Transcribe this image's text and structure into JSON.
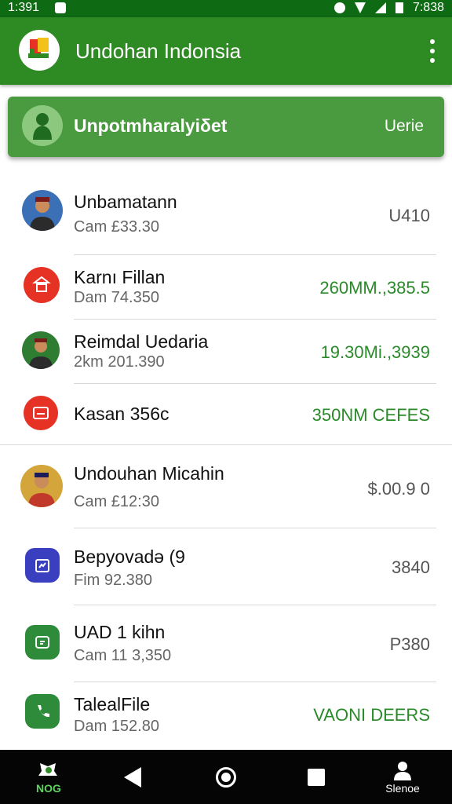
{
  "status_bar": {
    "time": "1:391",
    "right_time": "7:838"
  },
  "app_bar": {
    "title": "Undohan Indonsia"
  },
  "banner": {
    "title": "Unpotmharalyiδet",
    "action": "Uerie"
  },
  "rows": [
    {
      "name": "Unbamatann",
      "sub": "Cam £33.30",
      "value": "U410",
      "value_color": "gray",
      "avatar": "person-icon",
      "avatar_bg": "#3b6fb6"
    },
    {
      "name": "Karnı Fillan",
      "sub": "Dam 74.350",
      "value": "260MM.,385.5",
      "value_color": "green",
      "avatar": "temple-icon",
      "avatar_bg": "#e53225"
    },
    {
      "name": "Reimdal Uedaria",
      "sub": "2km 201.390",
      "value": "19.30Mi.,3939",
      "value_color": "green",
      "avatar": "person-icon",
      "avatar_bg": "#2e7d32"
    },
    {
      "name": "Kasan 356c",
      "sub": "",
      "value": "350NM CEFES",
      "value_color": "green",
      "avatar": "tv-icon",
      "avatar_bg": "#e53225"
    },
    {
      "name": "Undouhan Micahin",
      "sub": "Cam £12:30",
      "value": "$.00.9 0",
      "value_color": "gray",
      "avatar": "person-icon",
      "avatar_bg": "#d4a53a"
    },
    {
      "name": "Bepyovadə (9",
      "sub": "Fim 92.380",
      "value": "3840",
      "value_color": "gray",
      "avatar": "calendar-icon",
      "avatar_bg": "#3a3fbf"
    },
    {
      "name": "UAD 1 kihn",
      "sub": "Cam 11 3,350",
      "value": "P380",
      "value_color": "gray",
      "avatar": "chat-icon",
      "avatar_bg": "#2e8b3a"
    },
    {
      "name": "TalealFile",
      "sub": "Dam 152.80",
      "value": "VAONI DEERS",
      "value_color": "green",
      "avatar": "phone-icon",
      "avatar_bg": "#2e8b3a"
    }
  ],
  "nav": {
    "left_label": "NOG",
    "right_label": "Slenoe"
  }
}
